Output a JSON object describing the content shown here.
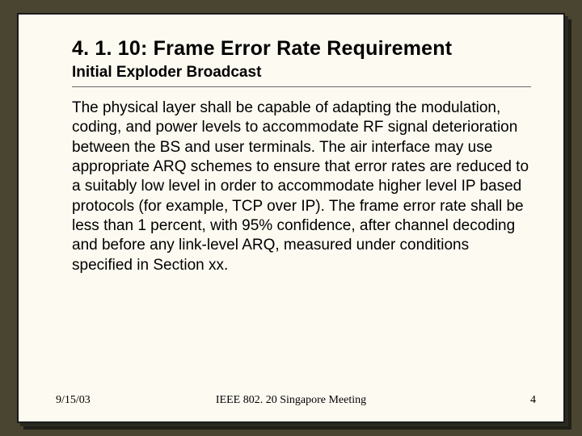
{
  "slide": {
    "title": "4. 1. 10: Frame Error Rate Requirement",
    "subtitle": "Initial Exploder Broadcast",
    "body": "The physical layer shall be capable of adapting the modulation, coding, and power levels to accommodate RF signal deterioration between the BS and user terminals. The air interface may use appropriate ARQ schemes to ensure that error rates are reduced to a suitably low level in order to accommodate higher level IP based protocols (for example, TCP over IP). The frame error rate shall be less than 1 percent, with 95% confidence, after channel decoding and before any link-level ARQ, measured under conditions specified in Section xx."
  },
  "footer": {
    "date": "9/15/03",
    "center": "IEEE 802. 20 Singapore Meeting",
    "page": "4"
  }
}
